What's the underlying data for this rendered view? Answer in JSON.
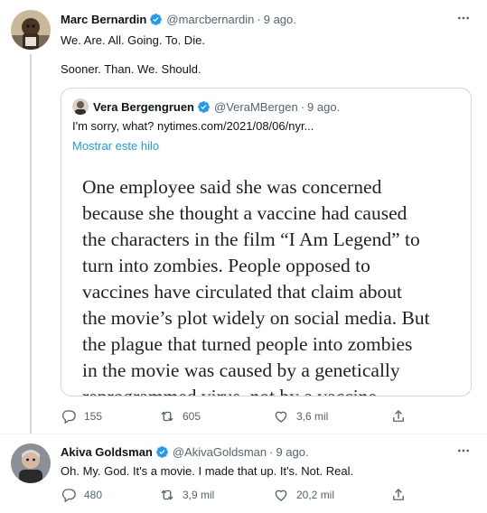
{
  "tweets": [
    {
      "author": {
        "name": "Marc Bernardin",
        "handle": "@marcbernardin",
        "time": "9 ago."
      },
      "lines": [
        "We. Are. All. Going. To. Die.",
        "Sooner. Than. We. Should."
      ],
      "quote": {
        "author": {
          "name": "Vera Bergengruen",
          "handle": "@VeraMBergen",
          "time": "9 ago."
        },
        "text": "I'm sorry, what? nytimes.com/2021/08/06/nyr...",
        "show_thread": "Mostrar este hilo",
        "image_lines": [
          "One employee said she was concerned",
          "because she thought a vaccine had caused",
          "the characters in the film “I Am Legend” to",
          "turn into zombies. People opposed to",
          "vaccines have circulated that claim about",
          "the movie’s plot widely on social media. But",
          "the plague that turned people into zombies",
          "in the movie was caused by a genetically",
          "reprogrammed virus, not by a vaccine."
        ]
      },
      "actions": {
        "replies": "155",
        "retweets": "605",
        "likes": "3,6 mil"
      }
    },
    {
      "author": {
        "name": "Akiva Goldsman",
        "handle": "@AkivaGoldsman",
        "time": "9 ago."
      },
      "lines": [
        "Oh. My. God. It's a movie. I made that up. It's. Not. Real."
      ],
      "actions": {
        "replies": "480",
        "retweets": "3,9 mil",
        "likes": "20,2 mil"
      }
    }
  ],
  "icons": [
    "verified-badge-icon",
    "more-icon",
    "reply-icon",
    "retweet-icon",
    "like-icon",
    "share-icon"
  ],
  "colors": {
    "verified": "#1d9bf0",
    "link": "#1d9bf0",
    "secondary_text": "#536471",
    "border": "#cfd9de"
  }
}
